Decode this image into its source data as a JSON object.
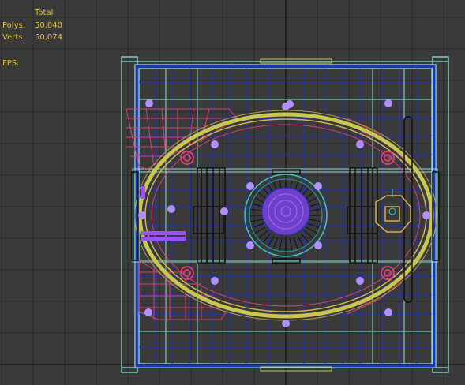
{
  "stats": {
    "total_label": "Total",
    "polys_label": "Polys:",
    "polys_value": "50,040",
    "verts_label": "Verts:",
    "verts_value": "50,074",
    "fps_label": "FPS:"
  },
  "colors": {
    "background": "#3a3a3a",
    "grid": "#2a2a2a",
    "grid_axis": "#1a1a1a",
    "cyan_frame": "#8fe0d8",
    "blue_frame": "#2030c8",
    "yellow_ring": "#c8c850",
    "red_mesh": "#d84070",
    "purple_points": "#b090ff",
    "stat_text": "#e6c23a"
  },
  "icons": [
    "vertex-point-icon"
  ]
}
